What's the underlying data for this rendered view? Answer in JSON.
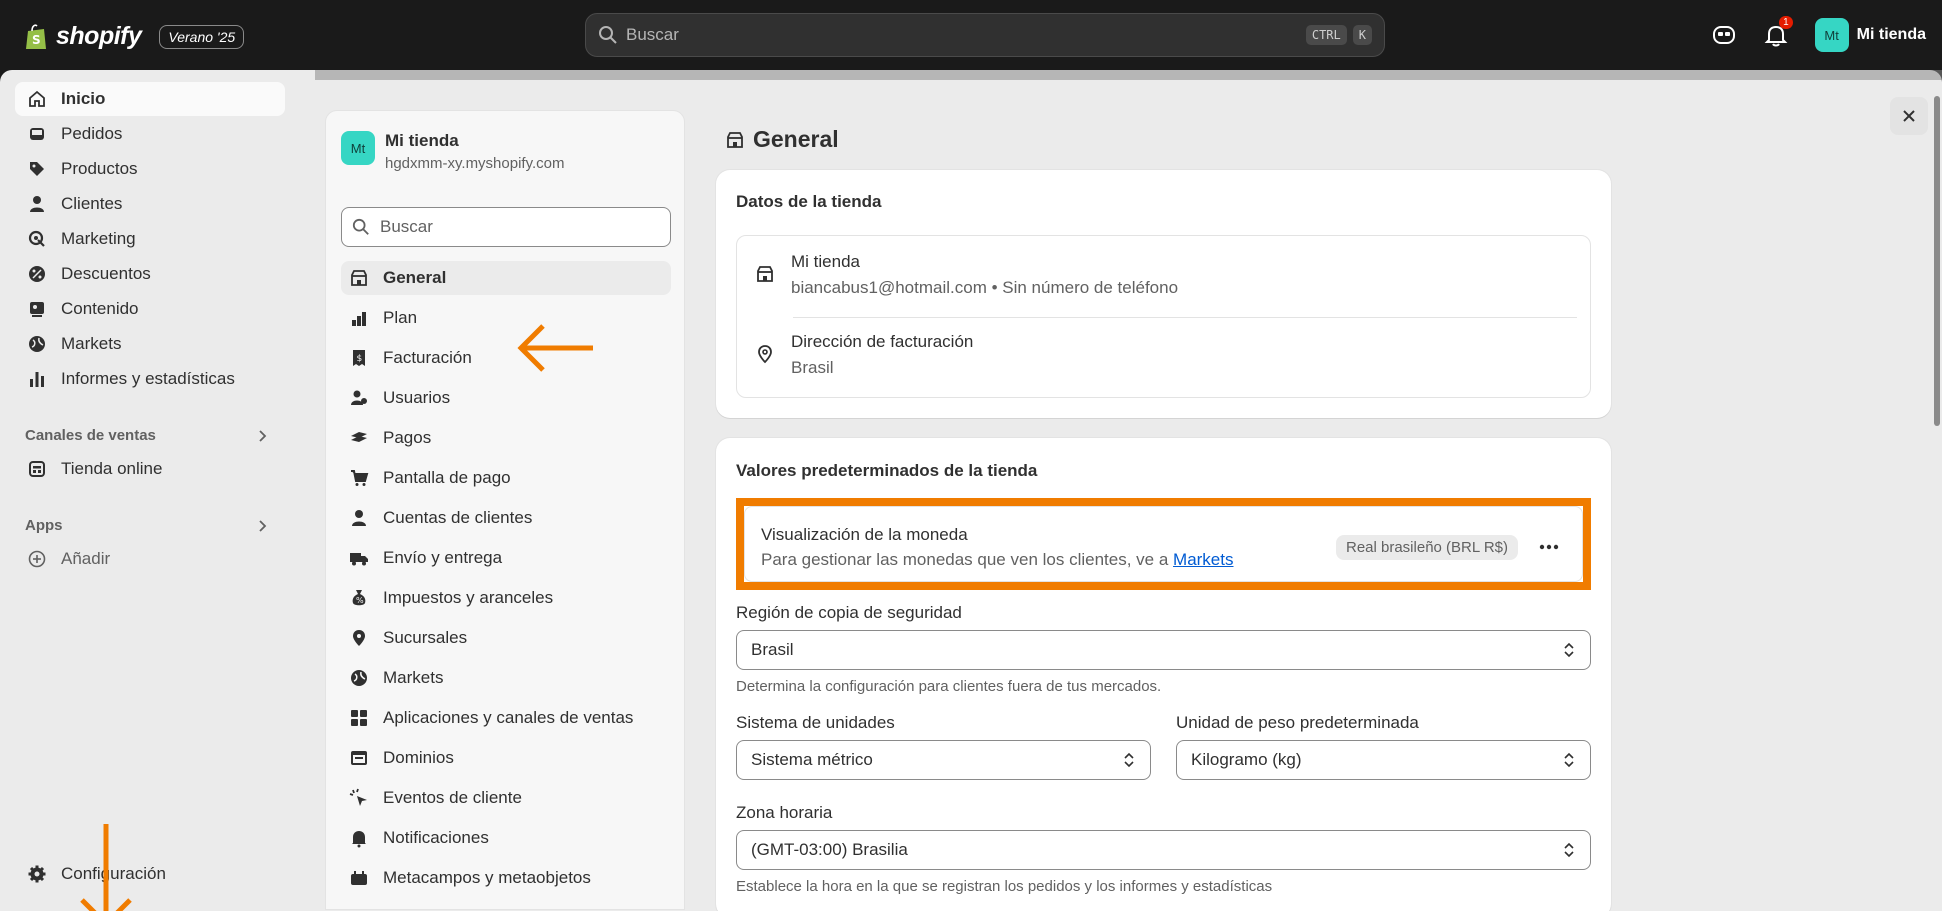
{
  "topbar": {
    "logo": "shopify",
    "edition": "Verano '25",
    "search_placeholder": "Buscar",
    "kbd1": "CTRL",
    "kbd2": "K",
    "notif_count": "1",
    "avatar": "Mt",
    "user_name": "Mi tienda"
  },
  "leftnav": {
    "items": [
      {
        "label": "Inicio",
        "icon": "home-icon"
      },
      {
        "label": "Pedidos",
        "icon": "inbox-icon"
      },
      {
        "label": "Productos",
        "icon": "tag-icon"
      },
      {
        "label": "Clientes",
        "icon": "person-icon"
      },
      {
        "label": "Marketing",
        "icon": "target-icon"
      },
      {
        "label": "Descuentos",
        "icon": "discount-icon"
      },
      {
        "label": "Contenido",
        "icon": "image-icon"
      },
      {
        "label": "Markets",
        "icon": "globe-icon"
      },
      {
        "label": "Informes y estadísticas",
        "icon": "chart-icon"
      }
    ],
    "sales_channels": "Canales de ventas",
    "online_store": "Tienda online",
    "apps": "Apps",
    "add": "Añadir",
    "settings": "Configuración"
  },
  "settings_panel": {
    "avatar": "Mt",
    "store_name": "Mi tienda",
    "store_url": "hgdxmm-xy.myshopify.com",
    "search_placeholder": "Buscar",
    "items": [
      "General",
      "Plan",
      "Facturación",
      "Usuarios",
      "Pagos",
      "Pantalla de pago",
      "Cuentas de clientes",
      "Envío y entrega",
      "Impuestos y aranceles",
      "Sucursales",
      "Markets",
      "Aplicaciones y canales de ventas",
      "Dominios",
      "Eventos de cliente",
      "Notificaciones",
      "Metacampos y metaobjetos"
    ]
  },
  "content": {
    "title": "General",
    "store_data": {
      "title": "Datos de la tienda",
      "store_name": "Mi tienda",
      "contact": "biancabus1@hotmail.com • Sin número de teléfono",
      "billing_label": "Dirección de facturación",
      "billing_value": "Brasil"
    },
    "defaults": {
      "title": "Valores predeterminados de la tienda",
      "currency_title": "Visualización de la moneda",
      "currency_desc": "Para gestionar las monedas que ven los clientes, ve a",
      "currency_link": "Markets",
      "currency_badge": "Real brasileño (BRL R$)",
      "backup_label": "Región de copia de seguridad",
      "backup_value": "Brasil",
      "backup_help": "Determina la configuración para clientes fuera de tus mercados.",
      "units_label": "Sistema de unidades",
      "units_value": "Sistema métrico",
      "weight_label": "Unidad de peso predeterminada",
      "weight_value": "Kilogramo (kg)",
      "tz_label": "Zona horaria",
      "tz_value": "(GMT-03:00) Brasilia",
      "tz_help": "Establece la hora en la que se registran los pedidos y los informes y estadísticas"
    }
  },
  "colors": {
    "annotation": "#f07c00",
    "accent_avatar": "#36d6c4",
    "link": "#005bd3"
  }
}
